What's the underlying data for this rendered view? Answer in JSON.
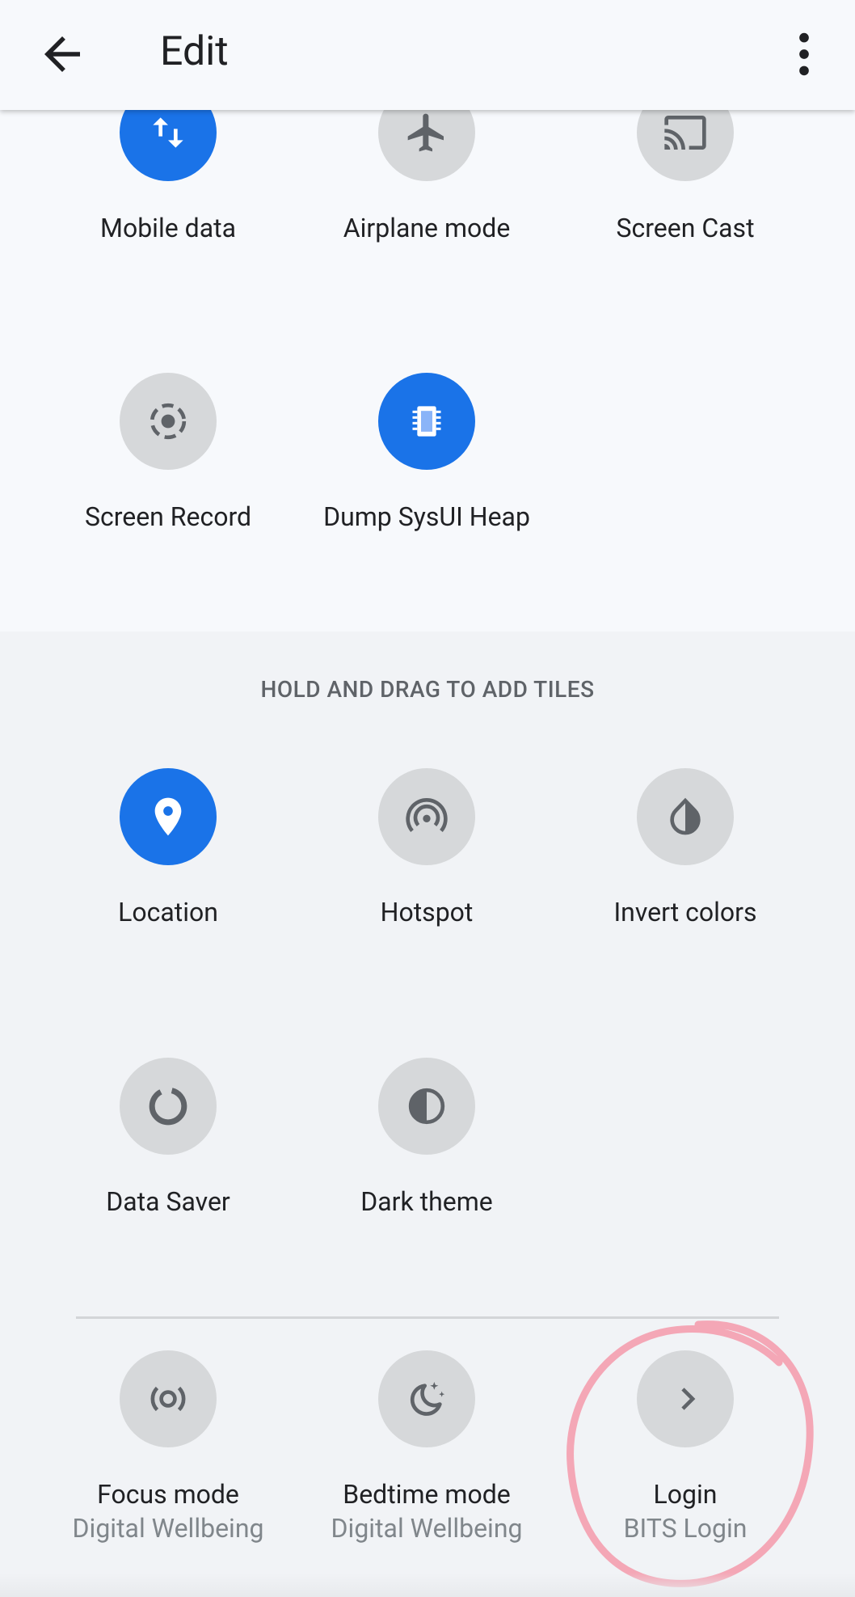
{
  "header": {
    "title": "Edit",
    "back_icon": "arrow-back-icon",
    "menu_icon": "more-vert-icon"
  },
  "active_tiles": [
    {
      "label": "Mobile data",
      "icon": "mobile-data-icon",
      "on": true
    },
    {
      "label": "Airplane mode",
      "icon": "airplane-icon",
      "on": false
    },
    {
      "label": "Screen Cast",
      "icon": "cast-icon",
      "on": false
    },
    {
      "label": "Screen Record",
      "icon": "screen-record-icon",
      "on": false
    },
    {
      "label": "Dump SysUI Heap",
      "icon": "memory-chip-icon",
      "on": true
    }
  ],
  "available": {
    "hint": "HOLD AND DRAG TO ADD TILES",
    "tiles": [
      {
        "label": "Location",
        "icon": "location-pin-icon",
        "on": true
      },
      {
        "label": "Hotspot",
        "icon": "hotspot-icon",
        "on": false
      },
      {
        "label": "Invert colors",
        "icon": "invert-colors-icon",
        "on": false
      },
      {
        "label": "Data Saver",
        "icon": "data-saver-icon",
        "on": false
      },
      {
        "label": "Dark theme",
        "icon": "dark-theme-icon",
        "on": false
      }
    ],
    "third_party_tiles": [
      {
        "label": "Focus mode",
        "sub": "Digital Wellbeing",
        "icon": "focus-mode-icon"
      },
      {
        "label": "Bedtime mode",
        "sub": "Digital Wellbeing",
        "icon": "bedtime-icon"
      },
      {
        "label": "Login",
        "sub": "BITS Login",
        "icon": "chevron-right-icon"
      }
    ]
  },
  "colors": {
    "accent": "#1a73e8",
    "tile_off": "#d6d8da",
    "annotation": "#f4a7b6"
  }
}
